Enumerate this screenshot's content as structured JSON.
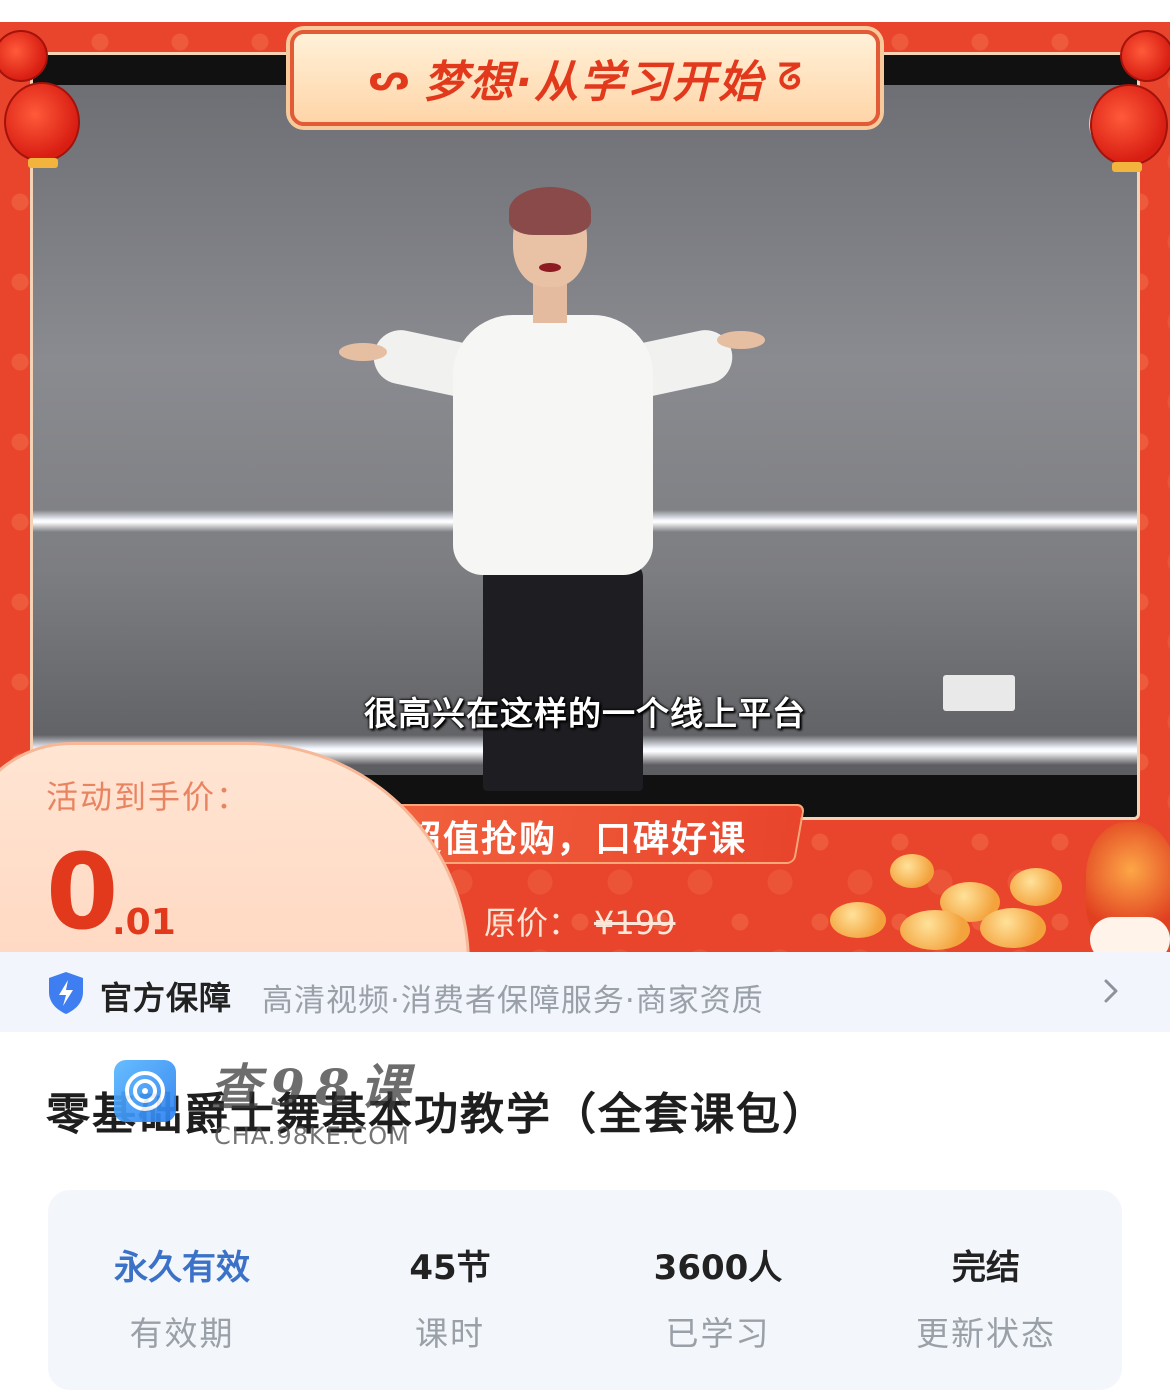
{
  "banner": {
    "headline": "梦想·从学习开始",
    "subtitle_caption": "很高兴在这样的一个线上平台",
    "promo_text": "超值抢购，口碑好课",
    "price_label": "活动到手价：",
    "price_integer": "0",
    "price_decimal": ".01",
    "original_price_label": "原价：",
    "original_price_value": "¥199",
    "colors": {
      "primary_red": "#e8452c",
      "price_red": "#e2391d",
      "cream": "#ffe5d3"
    }
  },
  "guarantee": {
    "title": "官方保障",
    "description": "高清视频·消费者保障服务·商家资质",
    "icon": "shield-lightning-icon",
    "arrow_icon": "chevron-right-icon"
  },
  "course": {
    "title": "零基础爵士舞基本功教学（全套课包）"
  },
  "watermark": {
    "text_cn": "查98课",
    "url": "CHA.98KE.COM"
  },
  "stats": [
    {
      "value": "永久有效",
      "label": "有效期",
      "accent": true
    },
    {
      "value": "45节",
      "label": "课时",
      "accent": false
    },
    {
      "value": "3600人",
      "label": "已学习",
      "accent": false
    },
    {
      "value": "完结",
      "label": "更新状态",
      "accent": false
    }
  ]
}
